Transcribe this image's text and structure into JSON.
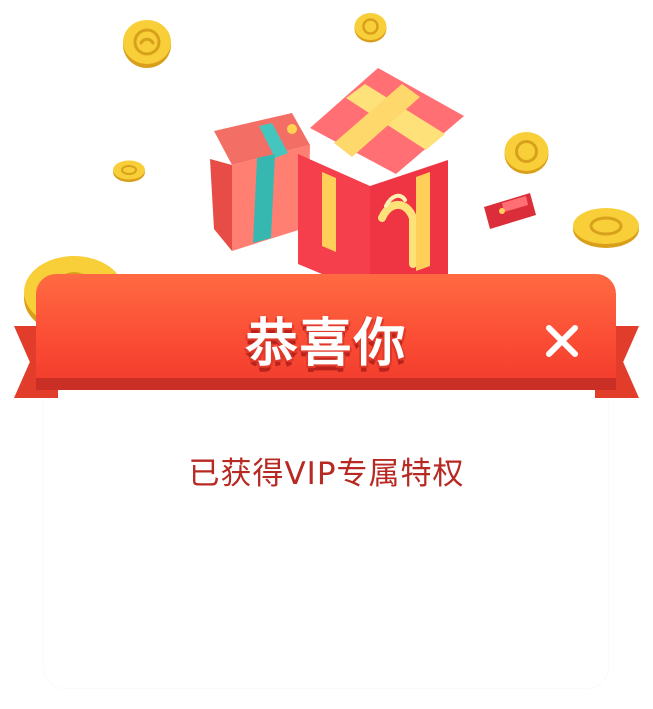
{
  "dialog": {
    "title": "恭喜你",
    "subtitle": "已获得VIP专属特权",
    "close_icon": "close-icon",
    "decorations": {
      "coins": "coin-icon",
      "gifts": "gift-box-icon",
      "red_envelope": "red-envelope-icon"
    }
  },
  "colors": {
    "ribbon": "#fb4d35",
    "ribbon_dark": "#c92f24",
    "title_text": "#ffffff",
    "subtitle_text": "#b72a23",
    "coin": "#f6c92f"
  }
}
